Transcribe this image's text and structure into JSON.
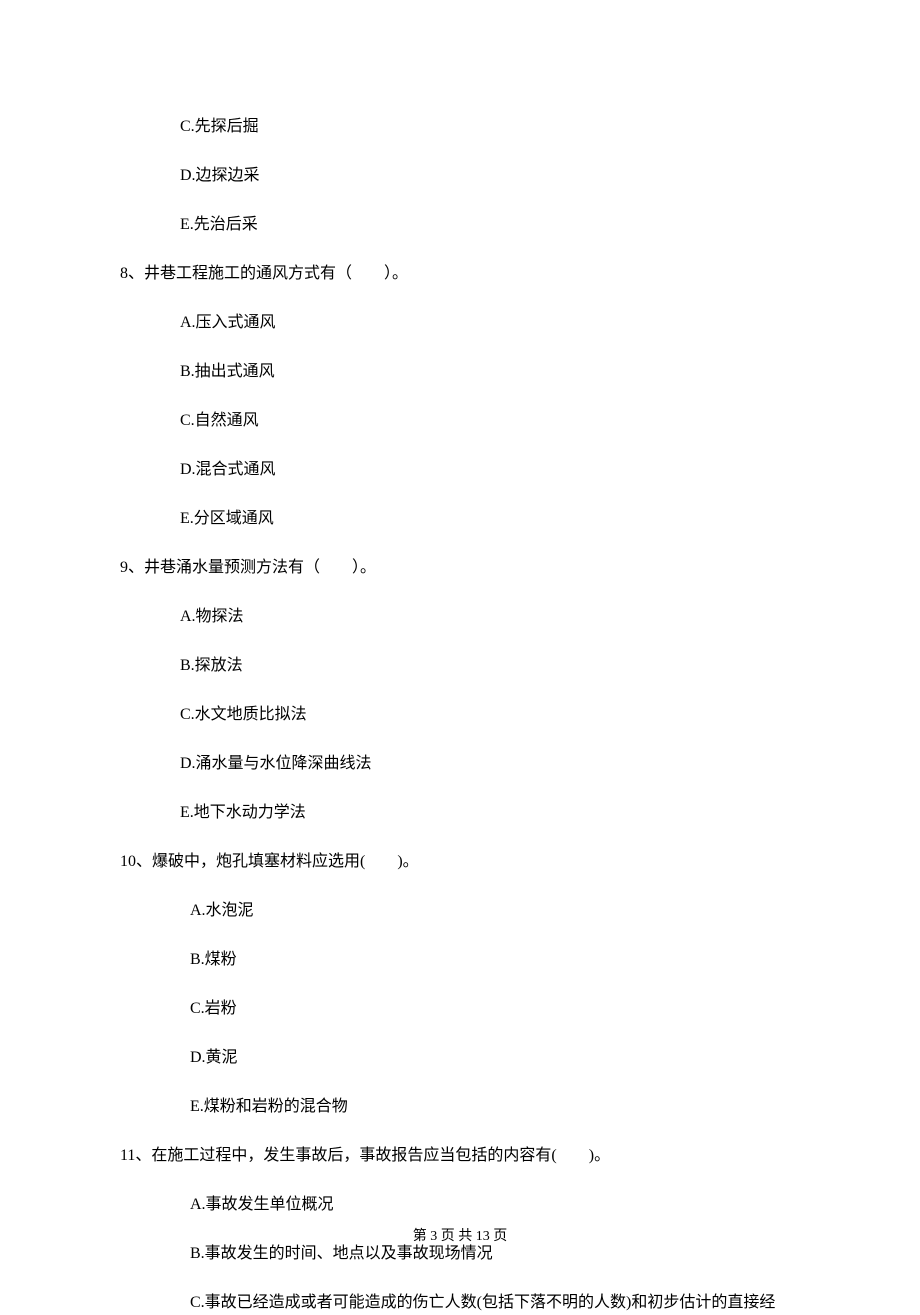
{
  "q7_continued": {
    "C": "C.先探后掘",
    "D": "D.边探边采",
    "E": "E.先治后采"
  },
  "q8": {
    "stem": "8、井巷工程施工的通风方式有（　　）。",
    "A": "A.压入式通风",
    "B": "B.抽出式通风",
    "C": "C.自然通风",
    "D": "D.混合式通风",
    "E": "E.分区域通风"
  },
  "q9": {
    "stem": "9、井巷涌水量预测方法有（　　）。",
    "A": "A.物探法",
    "B": "B.探放法",
    "C": "C.水文地质比拟法",
    "D": "D.涌水量与水位降深曲线法",
    "E": "E.地下水动力学法"
  },
  "q10": {
    "stem": "10、爆破中，炮孔填塞材料应选用(　　)。",
    "A": "A.水泡泥",
    "B": "B.煤粉",
    "C": "C.岩粉",
    "D": "D.黄泥",
    "E": "E.煤粉和岩粉的混合物"
  },
  "q11": {
    "stem": "11、在施工过程中，发生事故后，事故报告应当包括的内容有(　　)。",
    "A": "A.事故发生单位概况",
    "B": "B.事故发生的时间、地点以及事故现场情况",
    "C": "C.事故已经造成或者可能造成的伤亡人数(包括下落不明的人数)和初步估计的直接经"
  },
  "footer": "第 3 页 共 13 页"
}
